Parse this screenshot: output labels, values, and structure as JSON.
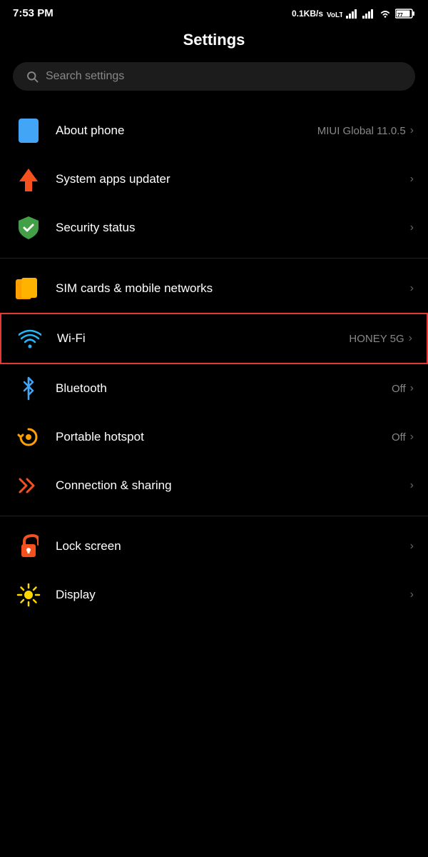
{
  "statusBar": {
    "time": "7:53 PM",
    "dataSpeed": "0.1KB/s",
    "networkType": "VoLTE",
    "battery": "77",
    "batteryIcon": "battery"
  },
  "pageTitle": "Settings",
  "search": {
    "placeholder": "Search settings"
  },
  "sections": [
    {
      "id": "top",
      "items": [
        {
          "id": "about-phone",
          "label": "About phone",
          "value": "MIUI Global 11.0.5",
          "icon": "phone-icon",
          "highlighted": false
        },
        {
          "id": "system-apps-updater",
          "label": "System apps updater",
          "value": "",
          "icon": "arrow-up-icon",
          "highlighted": false
        },
        {
          "id": "security-status",
          "label": "Security status",
          "value": "",
          "icon": "shield-icon",
          "highlighted": false
        }
      ]
    },
    {
      "id": "connectivity",
      "items": [
        {
          "id": "sim-cards",
          "label": "SIM cards & mobile networks",
          "value": "",
          "icon": "sim-icon",
          "highlighted": false
        },
        {
          "id": "wifi",
          "label": "Wi-Fi",
          "value": "HONEY 5G",
          "icon": "wifi-icon",
          "highlighted": true
        },
        {
          "id": "bluetooth",
          "label": "Bluetooth",
          "value": "Off",
          "icon": "bluetooth-icon",
          "highlighted": false
        },
        {
          "id": "portable-hotspot",
          "label": "Portable hotspot",
          "value": "Off",
          "icon": "hotspot-icon",
          "highlighted": false
        },
        {
          "id": "connection-sharing",
          "label": "Connection & sharing",
          "value": "",
          "icon": "connection-icon",
          "highlighted": false
        }
      ]
    },
    {
      "id": "device",
      "items": [
        {
          "id": "lock-screen",
          "label": "Lock screen",
          "value": "",
          "icon": "lock-icon",
          "highlighted": false
        },
        {
          "id": "display",
          "label": "Display",
          "value": "",
          "icon": "display-icon",
          "highlighted": false
        }
      ]
    }
  ],
  "chevron": "›"
}
